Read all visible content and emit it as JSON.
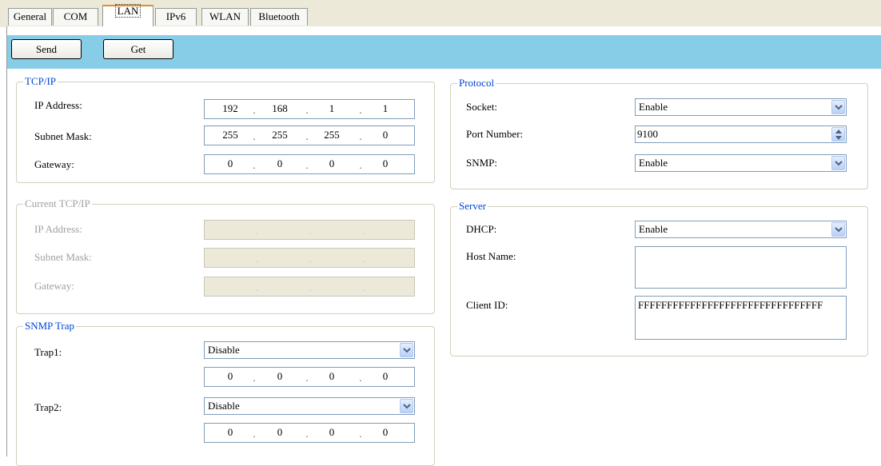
{
  "tabs": [
    "General",
    "COM",
    "LAN",
    "IPv6",
    "WLAN",
    "Bluetooth"
  ],
  "active_tab": "LAN",
  "toolbar": {
    "send_label": "Send",
    "get_label": "Get",
    "background": "#87cde7"
  },
  "tcpip": {
    "title": "TCP/IP",
    "ip_label": "IP Address:",
    "ip": [
      "192",
      "168",
      "1",
      "1"
    ],
    "mask_label": "Subnet Mask:",
    "mask": [
      "255",
      "255",
      "255",
      "0"
    ],
    "gateway_label": "Gateway:",
    "gateway": [
      "0",
      "0",
      "0",
      "0"
    ]
  },
  "current_tcpip": {
    "title": "Current TCP/IP",
    "ip_label": "IP Address:",
    "mask_label": "Subnet Mask:",
    "gateway_label": "Gateway:"
  },
  "snmp_trap": {
    "title": "SNMP Trap",
    "trap1_label": "Trap1:",
    "trap1_value": "Disable",
    "trap1_ip": [
      "0",
      "0",
      "0",
      "0"
    ],
    "trap2_label": "Trap2:",
    "trap2_value": "Disable",
    "trap2_ip": [
      "0",
      "0",
      "0",
      "0"
    ]
  },
  "protocol": {
    "title": "Protocol",
    "socket_label": "Socket:",
    "socket_value": "Enable",
    "port_label": "Port Number:",
    "port_value": "9100",
    "snmp_label": "SNMP:",
    "snmp_value": "Enable"
  },
  "server": {
    "title": "Server",
    "dhcp_label": "DHCP:",
    "dhcp_value": "Enable",
    "host_label": "Host Name:",
    "host_value": "",
    "client_label": "Client ID:",
    "client_value": "FFFFFFFFFFFFFFFFFFFFFFFFFFFFFFFF"
  },
  "icons": [
    "dropdown-arrow-icon",
    "spin-up-icon",
    "spin-down-icon"
  ]
}
